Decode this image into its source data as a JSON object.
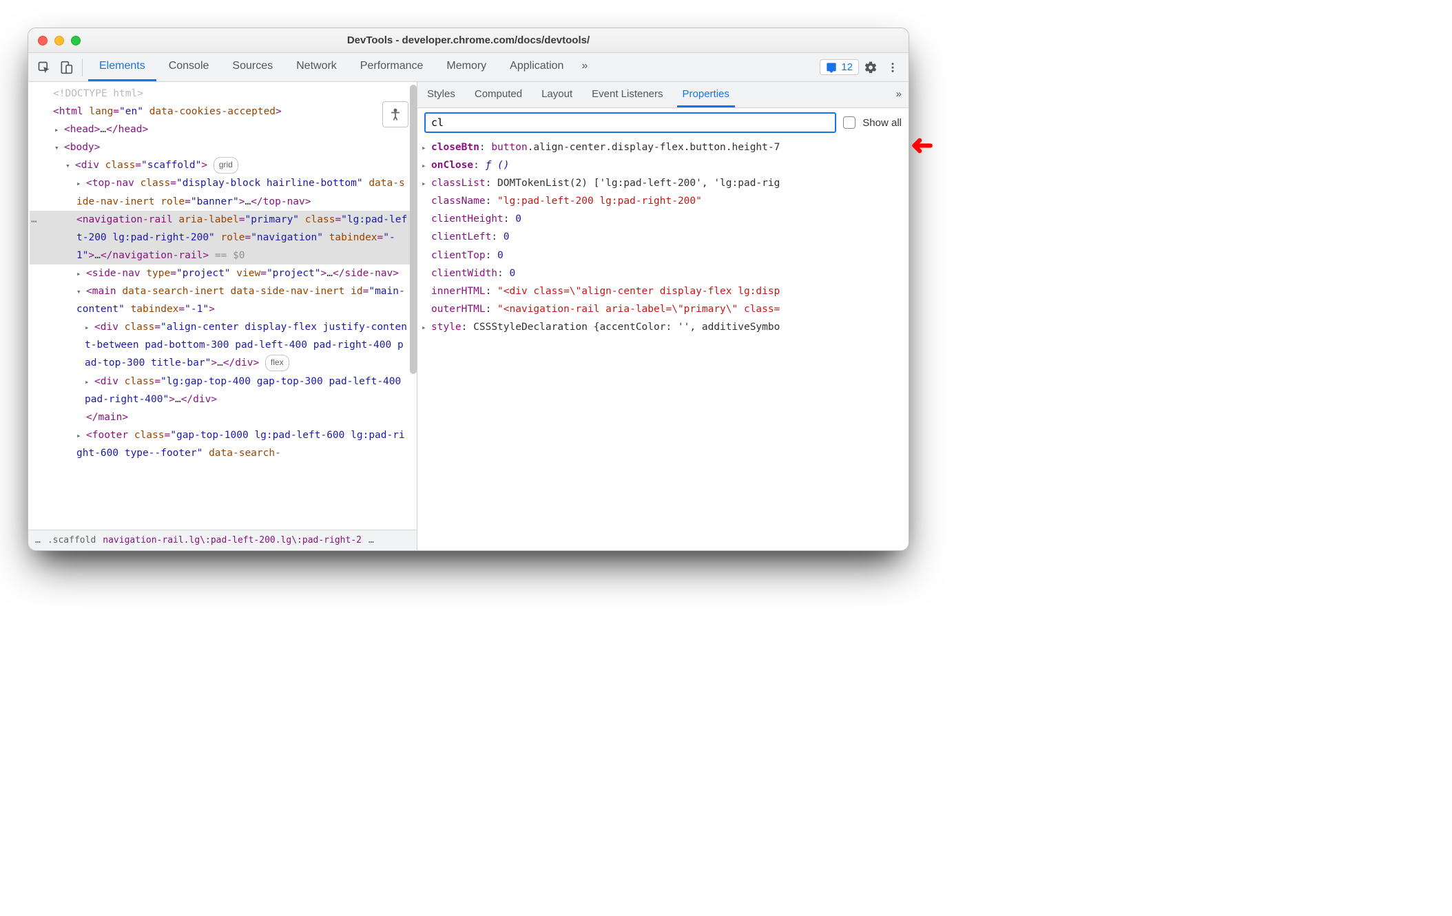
{
  "window": {
    "title": "DevTools - developer.chrome.com/docs/devtools/"
  },
  "tabs": {
    "items": [
      "Elements",
      "Console",
      "Sources",
      "Network",
      "Performance",
      "Memory",
      "Application"
    ],
    "more": "»",
    "active_index": 0,
    "issues_count": "12"
  },
  "elements": {
    "doctype": "<!DOCTYPE html>",
    "html_open": {
      "tag": "html",
      "attrs": [
        [
          "lang",
          "en"
        ],
        [
          "data-cookies-accepted",
          null
        ]
      ]
    },
    "head": {
      "tag": "head",
      "collapsed": "…"
    },
    "body": {
      "tag": "body"
    },
    "scaffold": {
      "tag": "div",
      "attrs": [
        [
          "class",
          "scaffold"
        ]
      ],
      "badge": "grid"
    },
    "topnav": {
      "tag": "top-nav",
      "attrs": [
        [
          "class",
          "display-block hairline-bottom"
        ],
        [
          "data-side-nav-inert",
          null
        ],
        [
          "role",
          "banner"
        ]
      ],
      "collapsed": "…"
    },
    "navrail": {
      "tag": "navigation-rail",
      "attrs": [
        [
          "aria-label",
          "primary"
        ],
        [
          "class",
          "lg:pad-left-200 lg:pad-right-200"
        ],
        [
          "role",
          "navigation"
        ],
        [
          "tabindex",
          "-1"
        ]
      ],
      "collapsed": "…",
      "selection": "== $0"
    },
    "sidenav": {
      "tag": "side-nav",
      "attrs": [
        [
          "type",
          "project"
        ],
        [
          "view",
          "project"
        ]
      ],
      "collapsed": "…"
    },
    "main": {
      "tag": "main",
      "attrs": [
        [
          "data-search-inert",
          null
        ],
        [
          "data-side-nav-inert",
          null
        ],
        [
          "id",
          "main-content"
        ],
        [
          "tabindex",
          "-1"
        ]
      ]
    },
    "titlebarDiv": {
      "tag": "div",
      "attrs": [
        [
          "class",
          "align-center display-flex justify-content-between pad-bottom-300 pad-left-400 pad-right-400 pad-top-300 title-bar"
        ]
      ],
      "collapsed": "…",
      "badge": "flex"
    },
    "gapDiv": {
      "tag": "div",
      "attrs": [
        [
          "class",
          "lg:gap-top-400 gap-top-300 pad-left-400 pad-right-400"
        ]
      ],
      "collapsed": "…"
    },
    "footer": {
      "tag": "footer",
      "attrs": [
        [
          "class",
          "gap-top-1000 lg:pad-left-600 lg:pad-right-600 type--footer"
        ],
        [
          "data-search-",
          null
        ]
      ]
    }
  },
  "breadcrumbs": {
    "items": [
      ".scaffold",
      "navigation-rail.lg\\:pad-left-200.lg\\:pad-right-2"
    ],
    "truncated_left": "…",
    "truncated_right": "…"
  },
  "sub_tabs": {
    "items": [
      "Styles",
      "Computed",
      "Layout",
      "Event Listeners",
      "Properties"
    ],
    "more": "»",
    "active_index": 4
  },
  "filter": {
    "value": "cl",
    "show_all_label": "Show all",
    "show_all_checked": false
  },
  "properties": [
    {
      "expandable": true,
      "key": "closeBtn",
      "bold": true,
      "value_kind": "selector",
      "value": "button.align-center.display-flex.button.height-7"
    },
    {
      "expandable": true,
      "key": "onClose",
      "bold": true,
      "value_kind": "func",
      "value": "ƒ ()"
    },
    {
      "expandable": true,
      "key": "classList",
      "value_kind": "obj",
      "value": "DOMTokenList(2) ['lg:pad-left-200', 'lg:pad-rig"
    },
    {
      "expandable": false,
      "key": "className",
      "value_kind": "str",
      "value": "\"lg:pad-left-200 lg:pad-right-200\""
    },
    {
      "expandable": false,
      "key": "clientHeight",
      "value_kind": "num",
      "value": "0"
    },
    {
      "expandable": false,
      "key": "clientLeft",
      "value_kind": "num",
      "value": "0"
    },
    {
      "expandable": false,
      "key": "clientTop",
      "value_kind": "num",
      "value": "0"
    },
    {
      "expandable": false,
      "key": "clientWidth",
      "value_kind": "num",
      "value": "0"
    },
    {
      "expandable": false,
      "key": "innerHTML",
      "value_kind": "str",
      "value": "\"<div class=\\\"align-center display-flex lg:disp"
    },
    {
      "expandable": false,
      "key": "outerHTML",
      "value_kind": "str",
      "value": "\"<navigation-rail aria-label=\\\"primary\\\" class="
    },
    {
      "expandable": true,
      "key": "style",
      "value_kind": "obj",
      "value": "CSSStyleDeclaration {accentColor: '', additiveSymbo"
    }
  ]
}
